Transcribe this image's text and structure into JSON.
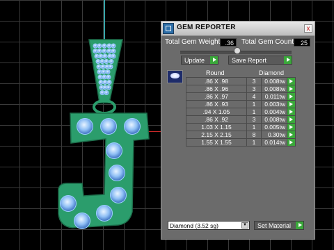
{
  "viewport": {
    "axis_v_color": "#3fc3c8",
    "axis_h_color": "#d02a2a",
    "grid_color": "#3a3a3a"
  },
  "model": {
    "metal_color": "#2b9d6c",
    "gem_color": "#7fb2f0",
    "bail_gem_count": 30,
    "letter_gem_count": 14
  },
  "panel": {
    "title": "GEM REPORTER",
    "close_label": "x",
    "total_weight_label": "Total Gem Weight",
    "total_weight_value": ".36",
    "total_count_label": "Total Gem Count",
    "total_count_value": "25",
    "update_label": "Update",
    "save_report_label": "Save Report",
    "table": {
      "col_shape": "Round",
      "col_material": "Diamond",
      "rows": [
        {
          "size": ".86 X .98",
          "count": "3",
          "tw": "0.008tw"
        },
        {
          "size": ".86 X .96",
          "count": "3",
          "tw": "0.008tw"
        },
        {
          "size": ".86 X .97",
          "count": "4",
          "tw": "0.011tw"
        },
        {
          "size": ".86 X .93",
          "count": "1",
          "tw": "0.003tw"
        },
        {
          "size": ".94 X 1.05",
          "count": "1",
          "tw": "0.004tw"
        },
        {
          "size": ".86 X .92",
          "count": "3",
          "tw": "0.008tw"
        },
        {
          "size": "1.03 X 1.15",
          "count": "1",
          "tw": "0.005tw"
        },
        {
          "size": "2.15 X 2.15",
          "count": "8",
          "tw": "0.30tw"
        },
        {
          "size": "1.55 X 1.55",
          "count": "1",
          "tw": "0.014tw"
        }
      ]
    },
    "material_select": {
      "value": "Diamond    (3.52 sg)",
      "arrow": "▼"
    },
    "set_material_label": "Set Material",
    "accent_green": "#3aa83a"
  }
}
